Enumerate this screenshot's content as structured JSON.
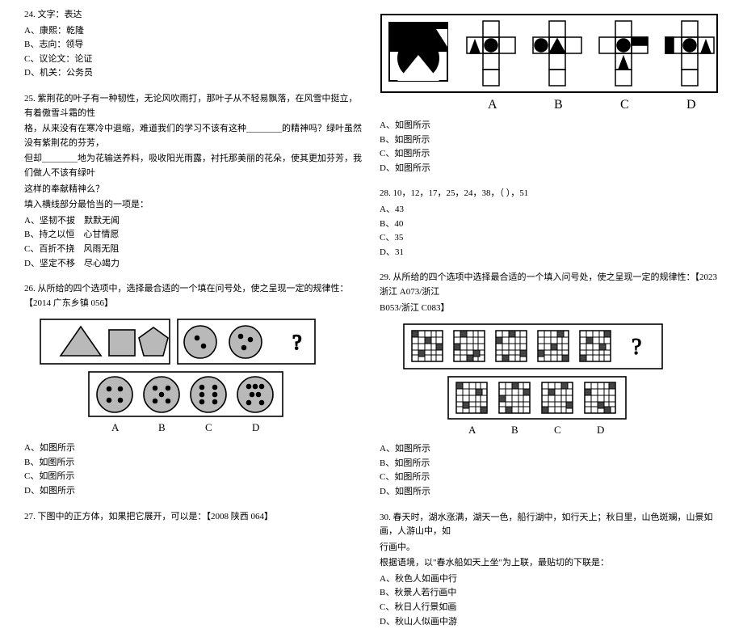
{
  "q24": {
    "stem": "24. 文字：表达",
    "a": "A、康熙：乾隆",
    "b": "B、志向：领导",
    "c": "C、议论文：论证",
    "d": "D、机关：公务员"
  },
  "q25": {
    "l1": "25. 紫荆花的叶子有一种韧性，无论风吹雨打，那叶子从不轻易飘落，在风雪中挺立，有着傲雪斗霜的性",
    "l2": "格，从来没有在寒冷中退缩，难道我们的学习不该有这种________的精神吗？绿叶虽然没有紫荆花的芬芳，",
    "l3": "但却________地为花输送养料，吸收阳光雨露，衬托那美丽的花朵，使其更加芬芳，我们做人不该有绿叶",
    "l4": "这样的奉献精神么？",
    "l5": "填入横线部分最恰当的一项是：",
    "a": {
      "t1": "A、坚韧不拔",
      "t2": "默默无闻"
    },
    "b": {
      "t1": "B、持之以恒",
      "t2": "心甘情愿"
    },
    "c": {
      "t1": "C、百折不挠",
      "t2": "风雨无阻"
    },
    "d": {
      "t1": "D、坚定不移",
      "t2": "尽心竭力"
    }
  },
  "q26": {
    "stem": "26. 从所给的四个选项中，选择最合适的一个填在问号处，使之呈现一定的规律性：【2014 广东乡镇 056】",
    "a": "A、如图所示",
    "b": "B、如图所示",
    "c": "C、如图所示",
    "d": "D、如图所示",
    "labA": "A",
    "labB": "B",
    "labC": "C",
    "labD": "D"
  },
  "q27": {
    "stem": "27. 下图中的正方体，如果把它展开，可以是：【2008 陕西 064】",
    "a": "A、如图所示",
    "b": "B、如图所示",
    "c": "C、如图所示",
    "d": "D、如图所示",
    "labA": "A",
    "labB": "B",
    "labC": "C",
    "labD": "D"
  },
  "q28": {
    "stem": "28. 10，12，17，25，24，38，（    ），51",
    "a": "A、43",
    "b": "B、40",
    "c": "C、35",
    "d": "D、31"
  },
  "q29": {
    "l1": "29. 从所给的四个选项中选择最合适的一个填入问号处，使之呈现一定的规律性：【2023 浙江 A073/浙江",
    "l2": "B053/浙江 C083】",
    "a": "A、如图所示",
    "b": "B、如图所示",
    "c": "C、如图所示",
    "d": "D、如图所示",
    "labA": "A",
    "labB": "B",
    "labC": "C",
    "labD": "D"
  },
  "q30": {
    "l1": "30. 春天时，湖水涨满，湖天一色，船行湖中，如行天上；秋日里，山色斑斓，山景如画，人游山中，如",
    "l2": "行画中。",
    "l3": "根据语境，以\"春水船如天上坐\"为上联，最贴切的下联是：",
    "a": "A、秋色人如画中行",
    "b": "B、秋景人若行画中",
    "c": "C、秋日人行景如画",
    "d": "D、秋山人似画中游"
  }
}
